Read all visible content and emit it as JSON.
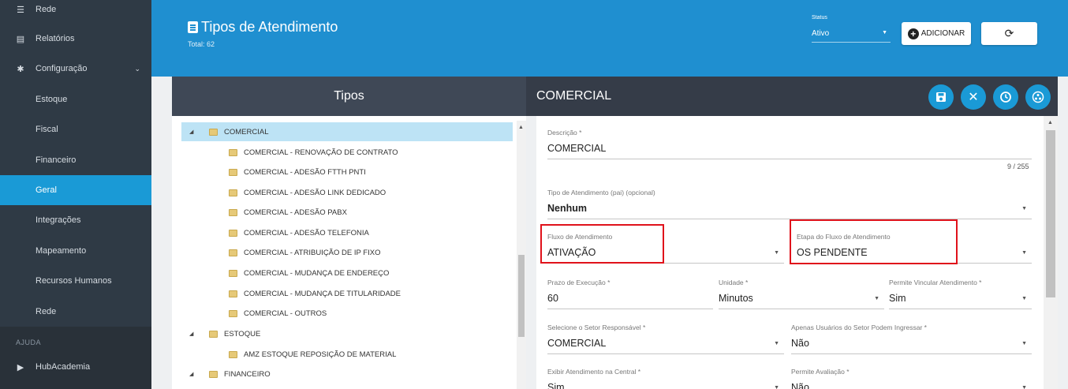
{
  "sidebar": {
    "items": [
      {
        "label": "Rede",
        "icon": "server-icon"
      },
      {
        "label": "Relatórios",
        "icon": "document-icon"
      },
      {
        "label": "Configuração",
        "icon": "gear-icon"
      },
      {
        "label": "Estoque"
      },
      {
        "label": "Fiscal"
      },
      {
        "label": "Financeiro"
      },
      {
        "label": "Geral"
      },
      {
        "label": "Integrações"
      },
      {
        "label": "Mapeamento"
      },
      {
        "label": "Recursos Humanos"
      },
      {
        "label": "Rede"
      }
    ],
    "section_ajuda": "AJUDA",
    "hubacademia": "HubAcademia"
  },
  "header": {
    "title": "Tipos de Atendimento",
    "total": "Total: 62",
    "status_label": "Status",
    "status_value": "Ativo",
    "add_label": "ADICIONAR",
    "refresh_glyph": "⟳"
  },
  "left_panel": {
    "title": "Tipos",
    "tree": [
      {
        "label": "COMERCIAL",
        "level": 0
      },
      {
        "label": "COMERCIAL - RENOVAÇÃO DE CONTRATO",
        "level": 1
      },
      {
        "label": "COMERCIAL - ADESÃO FTTH PNTI",
        "level": 1
      },
      {
        "label": "COMERCIAL - ADESÃO LINK DEDICADO",
        "level": 1
      },
      {
        "label": "COMERCIAL - ADESÃO PABX",
        "level": 1
      },
      {
        "label": "COMERCIAL - ADESÃO TELEFONIA",
        "level": 1
      },
      {
        "label": "COMERCIAL - ATRIBUIÇÃO DE IP FIXO",
        "level": 1
      },
      {
        "label": "COMERCIAL - MUDANÇA DE ENDEREÇO",
        "level": 1
      },
      {
        "label": "COMERCIAL - MUDANÇA DE TITULARIDADE",
        "level": 1
      },
      {
        "label": "COMERCIAL - OUTROS",
        "level": 1
      },
      {
        "label": "ESTOQUE",
        "level": 0
      },
      {
        "label": "AMZ ESTOQUE REPOSIÇÃO DE MATERIAL",
        "level": 1
      },
      {
        "label": "FINANCEIRO",
        "level": 0
      }
    ]
  },
  "right_panel": {
    "title": "COMERCIAL",
    "descricao_label": "Descrição *",
    "descricao_value": "COMERCIAL",
    "descricao_counter": "9 / 255",
    "tipo_pai_label": "Tipo de Atendimento (pai) (opcional)",
    "tipo_pai_value": "Nenhum",
    "fluxo_label": "Fluxo de Atendimento",
    "fluxo_value": "ATIVAÇÃO",
    "etapa_label": "Etapa do Fluxo de Atendimento",
    "etapa_value": "OS PENDENTE",
    "prazo_label": "Prazo de Execução *",
    "prazo_value": "60",
    "unidade_label": "Unidade *",
    "unidade_value": "Minutos",
    "permite_vinc_label": "Permite Vincular Atendimento *",
    "permite_vinc_value": "Sim",
    "setor_label": "Selecione o Setor Responsável *",
    "setor_value": "COMERCIAL",
    "apenas_label": "Apenas Usuários do Setor Podem Ingressar *",
    "apenas_value": "Não",
    "exibir_label": "Exibir Atendimento na Central *",
    "exibir_value": "Sim",
    "avaliacao_label": "Permite Avaliação *",
    "avaliacao_value": "Não"
  }
}
